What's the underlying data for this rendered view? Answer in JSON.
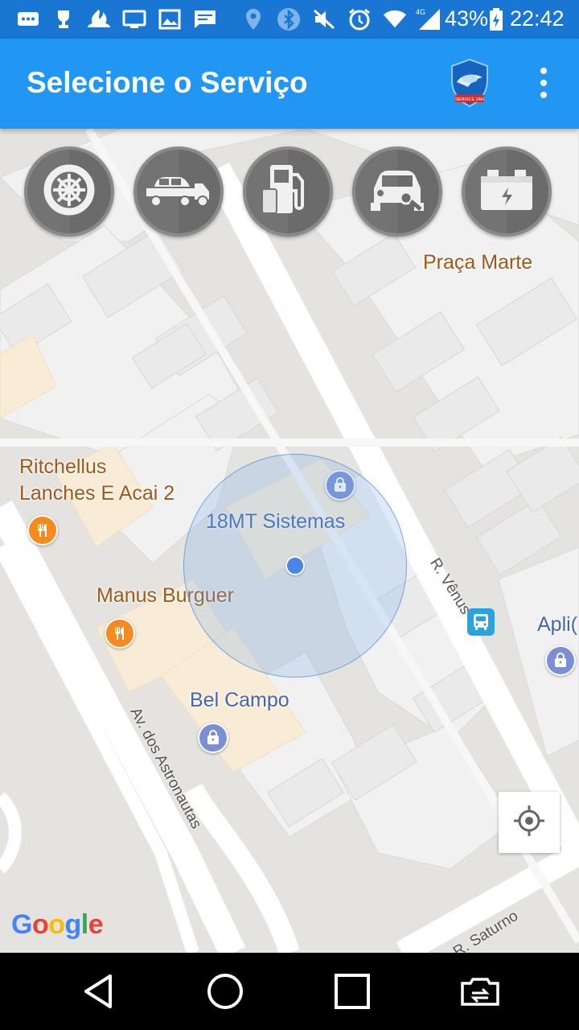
{
  "status_bar": {
    "battery": "43%",
    "time": "22:42",
    "network": "4G",
    "icons": [
      "messages-icon",
      "trophy-icon",
      "santander-icon",
      "screen-icon",
      "gallery-icon",
      "chat-icon",
      "location-icon",
      "bluetooth-icon",
      "mute-icon",
      "alarm-icon",
      "wifi-icon",
      "signal-icon",
      "battery-icon"
    ]
  },
  "app_bar": {
    "title": "Selecione o Serviço",
    "logo": "service-24h-shield-logo",
    "logo_text": "SERVICE 24H",
    "menu_icon": "more-vert-icon"
  },
  "services": [
    {
      "name": "tire-service",
      "icon": "tire-icon"
    },
    {
      "name": "tow-truck-service",
      "icon": "tow-truck-icon"
    },
    {
      "name": "fuel-service",
      "icon": "fuel-pump-icon"
    },
    {
      "name": "locksmith-service",
      "icon": "car-key-icon"
    },
    {
      "name": "battery-service",
      "icon": "car-battery-icon"
    }
  ],
  "map": {
    "places": {
      "praca_marte": "Praça Marte",
      "ritchellus": "Ritchellus\nLanches E Acai 2",
      "mt_sistemas": "18MT Sistemas",
      "manus": "Manus Burguer",
      "bel_campo": "Bel Campo",
      "apli": "Apli("
    },
    "streets": {
      "venus": "R. Vênus",
      "astronautas": "Av. dos Astronautas",
      "saturno": "R. Saturno"
    },
    "attribution": "Google",
    "colors": {
      "road": "#ffffff",
      "block": "#f2f2f2",
      "commercial": "#f8ecd6",
      "accuracy": "#4a86e8",
      "food_pin": "#f58a1f",
      "shop_pin": "#7a8fd6"
    }
  },
  "nav_bar": {
    "buttons": [
      "back-icon",
      "home-icon",
      "recents-icon",
      "switch-app-icon"
    ]
  }
}
